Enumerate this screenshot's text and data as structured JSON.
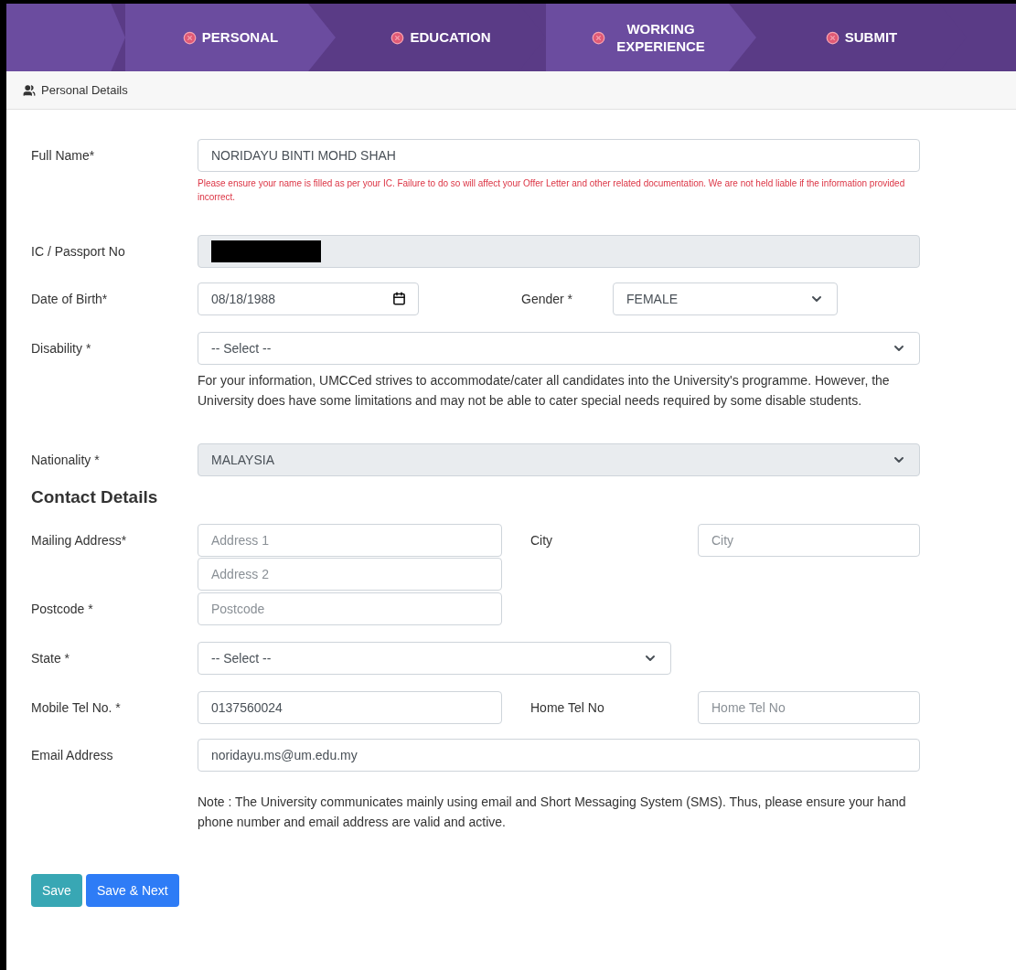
{
  "steps": [
    {
      "label": "PERSONAL",
      "complete": false
    },
    {
      "label": "EDUCATION",
      "complete": false
    },
    {
      "label": "WORKING EXPERIENCE",
      "complete": false
    },
    {
      "label": "SUBMIT",
      "complete": false
    }
  ],
  "panel": {
    "title": "Personal Details"
  },
  "personal": {
    "full_name": {
      "label": "Full Name*",
      "value": "NORIDAYU BINTI MOHD SHAH",
      "hint": "Please ensure your name is filled as per your IC. Failure to do so will affect your Offer Letter and other related documentation. We are not held liable if the information provided incorrect."
    },
    "ic_passport": {
      "label": "IC / Passport No",
      "disabled": true
    },
    "date_of_birth": {
      "label": "Date of Birth*",
      "value": "08/18/1988"
    },
    "gender": {
      "label": "Gender *",
      "value": "FEMALE"
    },
    "disability": {
      "label": "Disability *",
      "value": "-- Select --",
      "info": "For your information, UMCCed strives to accommodate/cater all candidates into the University's programme. However, the University does have some limitations and may not be able to cater special needs required by some disable students."
    },
    "nationality": {
      "label": "Nationality *",
      "value": "MALAYSIA",
      "disabled": true
    }
  },
  "contact": {
    "heading": "Contact Details",
    "mailing_address": {
      "label": "Mailing Address*",
      "line1_placeholder": "Address 1",
      "line2_placeholder": "Address 2"
    },
    "city": {
      "label": "City",
      "placeholder": "City"
    },
    "postcode": {
      "label": "Postcode *",
      "placeholder": "Postcode"
    },
    "state": {
      "label": "State *",
      "value": "-- Select --"
    },
    "mobile": {
      "label": "Mobile Tel No. *",
      "value": "0137560024"
    },
    "home_tel": {
      "label": "Home Tel No",
      "placeholder": "Home Tel No"
    },
    "email": {
      "label": "Email Address",
      "value": "noridayu.ms@um.edu.my"
    },
    "note": "Note : The University communicates mainly using email and Short Messaging System (SMS). Thus, please ensure your hand phone number and email address are valid and active."
  },
  "buttons": [
    {
      "label": "Save",
      "kind": "secondary"
    },
    {
      "label": "Save & Next",
      "kind": "primary"
    }
  ]
}
